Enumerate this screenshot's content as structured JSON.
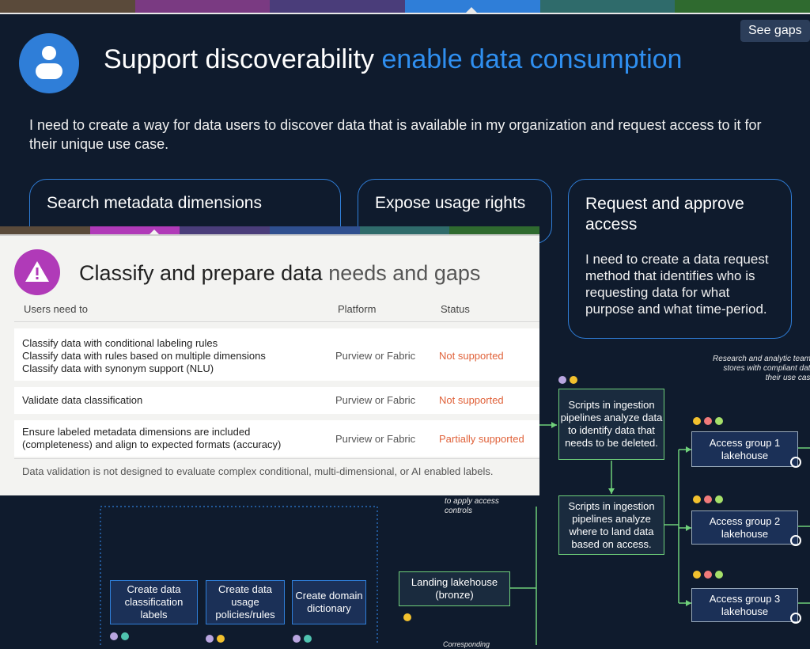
{
  "nav": {
    "segment_colors": [
      "#5a4a3a",
      "#7a3a82",
      "#4a3d7a",
      "#2f7ed8",
      "#2f6b6b",
      "#2f6a2f"
    ]
  },
  "hero": {
    "title": "Support discoverability",
    "title_accent": "enable data consumption",
    "description": "I need to create a way for data users to discover data that is available in my organization and request access to it for their unique use case.",
    "see_gaps": "See gaps",
    "icon": "user-icon"
  },
  "cards": {
    "search": {
      "title": "Search metadata dimensions"
    },
    "usage": {
      "title": "Expose usage rights"
    },
    "request": {
      "title": "Request and approve access",
      "description": "I need to create a data request method that identifies who is requesting data for what purpose and what time-period."
    }
  },
  "panel": {
    "title": "Classify and prepare data",
    "subtitle": "needs and gaps",
    "icon": "warning-icon",
    "headers": {
      "need": "Users need to",
      "platform": "Platform",
      "status": "Status"
    },
    "rows": [
      {
        "needs": [
          "Classify data with conditional labeling rules",
          "Classify data with rules based on multiple dimensions",
          "Classify data with synonym support (NLU)"
        ],
        "platform": "Purview or Fabric",
        "status": "Not supported"
      },
      {
        "needs": [
          "Validate data classification"
        ],
        "platform": "Purview or Fabric",
        "status": "Not supported"
      },
      {
        "needs": [
          "Ensure labeled metadata dimensions are included",
          "(completeness) and align to expected formats (accuracy)"
        ],
        "platform": "Purview or Fabric",
        "status": "Partially supported"
      }
    ],
    "note": "Data validation is not designed to evaluate complex conditional, multi-dimensional, or AI enabled labels.",
    "colors": {
      "bar": [
        "#5a4a3a",
        "#b03ab8",
        "#4a3d7a",
        "#2f4f8f",
        "#2f6b6b",
        "#2f6a2f"
      ],
      "status": "#e0623a"
    }
  },
  "diagram": {
    "research_note": [
      "Research and analytic teams",
      "stores with compliant data",
      "their use case"
    ],
    "scripts_delete": "Scripts in ingestion pipelines analyze data to identify data that needs to be deleted.",
    "scripts_land": "Scripts in ingestion pipelines analyze where to land data based on access.",
    "apply_note": [
      "to apply access",
      "controls"
    ],
    "landing": "Landing lakehouse (bronze)",
    "groups": [
      "Access group 1 lakehouse",
      "Access group 2 lakehouse",
      "Access group 3 lakehouse"
    ],
    "blue_boxes": [
      "Create data classification labels",
      "Create data usage policies/rules",
      "Create domain dictionary"
    ],
    "bottom_note": "Corresponding"
  }
}
